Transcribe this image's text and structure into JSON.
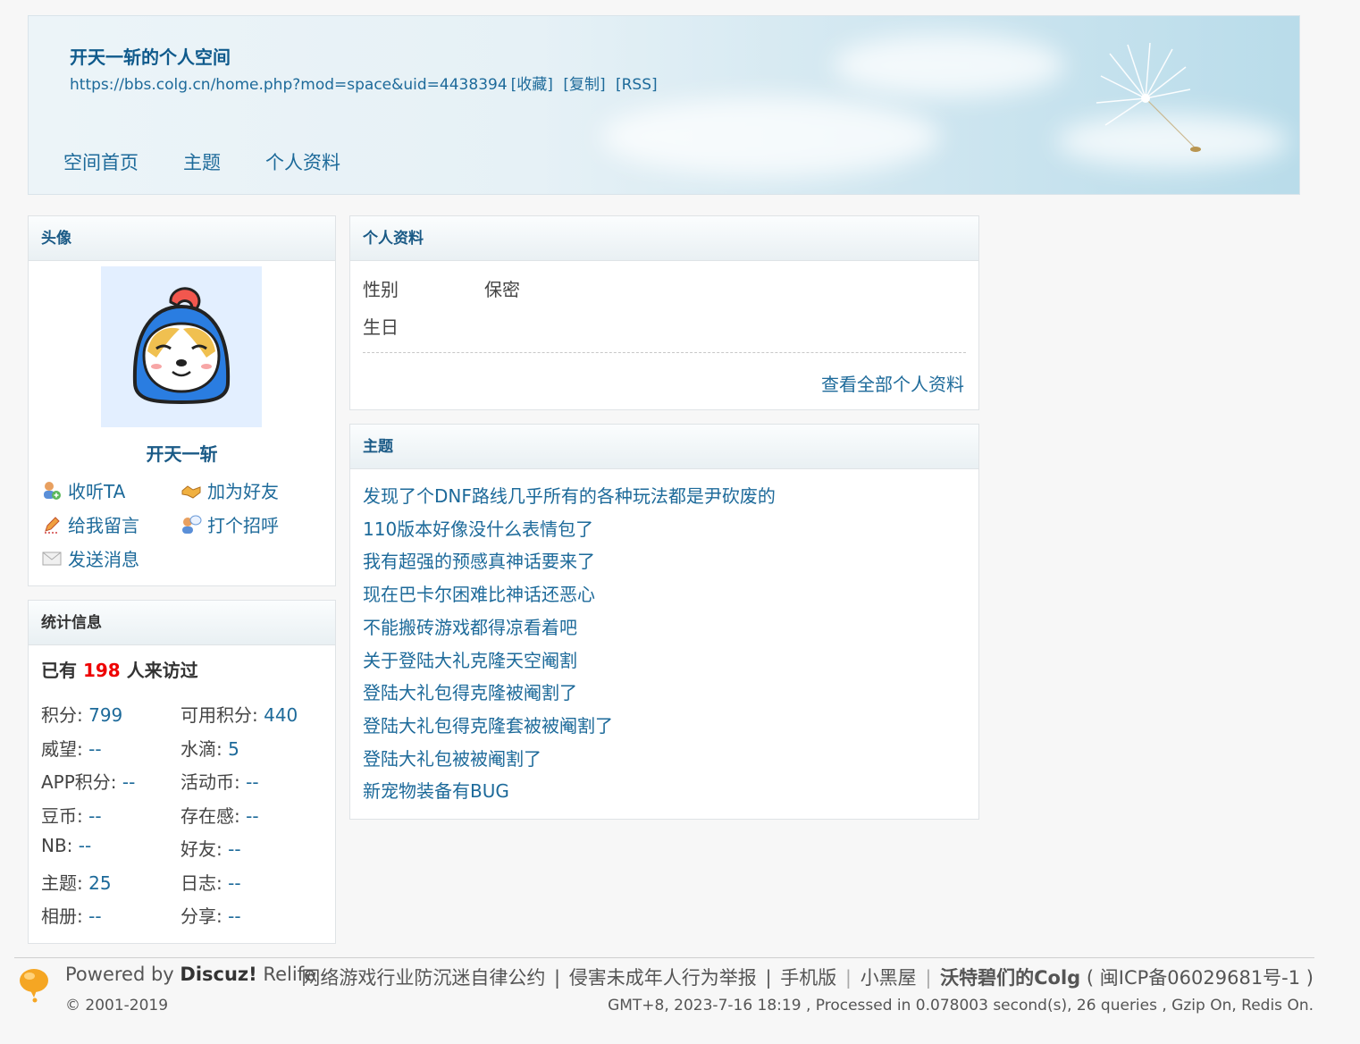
{
  "header": {
    "title": "开天一斩的个人空间",
    "url": "https://bbs.colg.cn/home.php?mod=space&uid=4438394",
    "url_actions": [
      "[收藏]",
      "[复制]",
      "[RSS]"
    ],
    "nav": [
      "空间首页",
      "主题",
      "个人资料"
    ]
  },
  "avatar_panel": {
    "title": "头像",
    "username": "开天一斩",
    "actions": {
      "follow": "收听TA",
      "add_friend": "加为好友",
      "message_board": "给我留言",
      "poke": "打个招呼",
      "send_pm": "发送消息"
    }
  },
  "stats_panel": {
    "title": "统计信息",
    "visitors_prefix": "已有",
    "visitors_count": "198",
    "visitors_suffix": "人来访过",
    "items": [
      {
        "label": "积分:",
        "value": "799"
      },
      {
        "label": "可用积分:",
        "value": "440"
      },
      {
        "label": "威望:",
        "value": "--"
      },
      {
        "label": "水滴:",
        "value": "5"
      },
      {
        "label": "APP积分:",
        "value": "--"
      },
      {
        "label": "活动币:",
        "value": "--"
      },
      {
        "label": "豆币:",
        "value": "--"
      },
      {
        "label": "存在感:",
        "value": "--"
      },
      {
        "label": "NB:",
        "value": "--"
      },
      {
        "label": "好友:",
        "value": "--"
      },
      {
        "label": "主题:",
        "value": "25"
      },
      {
        "label": "日志:",
        "value": "--"
      },
      {
        "label": "相册:",
        "value": "--"
      },
      {
        "label": "分享:",
        "value": "--"
      }
    ]
  },
  "profile_panel": {
    "title": "个人资料",
    "gender_label": "性别",
    "gender_value": "保密",
    "birthday_label": "生日",
    "more_link": "查看全部个人资料"
  },
  "threads_panel": {
    "title": "主题",
    "threads": [
      "发现了个DNF路线几乎所有的各种玩法都是尹砍废的",
      "110版本好像没什么表情包了",
      "我有超强的预感真神话要来了",
      "现在巴卡尔困难比神话还恶心",
      "不能搬砖游戏都得凉看着吧",
      "关于登陆大礼克隆天空阉割",
      "登陆大礼包得克隆被阉割了",
      "登陆大礼包得克隆套被被阉割了",
      "登陆大礼包被被阉割了",
      "新宠物装备有BUG"
    ]
  },
  "footer": {
    "powered_prefix": "Powered by",
    "powered_brand": "Discuz!",
    "powered_suffix": "Relife",
    "copyright": "© 2001-2019",
    "links": {
      "self_discipline": "网络游戏行业防沉迷自律公约",
      "report": "侵害未成年人行为举报",
      "mobile": "手机版",
      "blackroom": "小黑屋",
      "site_name": "沃特碧们的Colg",
      "icp": "( 闽ICP备06029681号-1 )"
    },
    "pipe": "|",
    "debug": "GMT+8, 2023-7-16 18:19 , Processed in 0.078003 second(s), 26 queries , Gzip On, Redis On."
  }
}
